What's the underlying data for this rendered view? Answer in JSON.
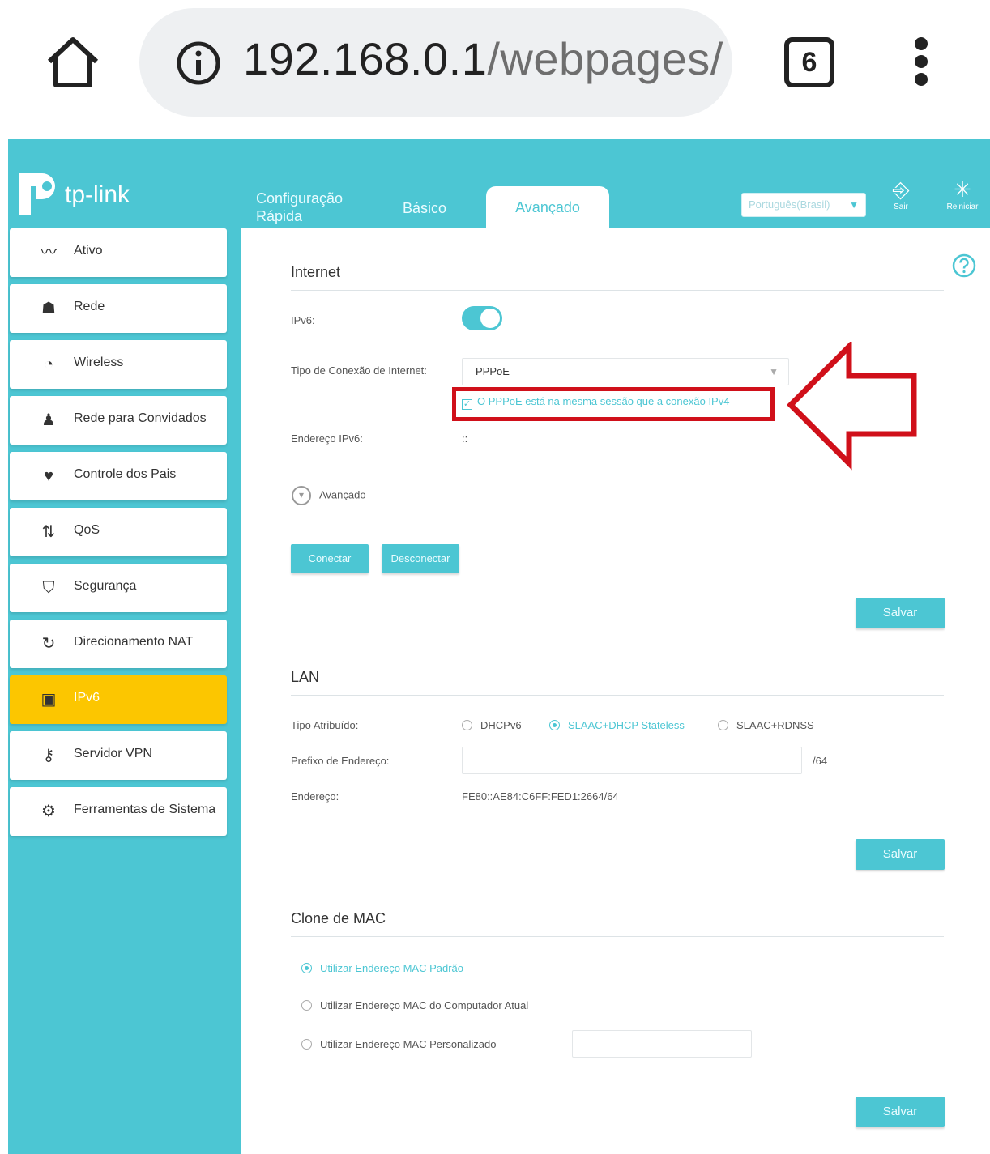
{
  "browser": {
    "url_host": "192.168.0.1",
    "url_path": "/webpages/",
    "tab_count": "6"
  },
  "brand": {
    "logo_text": "tp-link"
  },
  "top_nav": {
    "tabs": [
      {
        "label": "Configuração Rápida"
      },
      {
        "label": "Básico"
      },
      {
        "label": "Avançado"
      }
    ],
    "language": "Português(Brasil)",
    "logout_label": "Sair",
    "reboot_label": "Reiniciar"
  },
  "sidebar": {
    "items": [
      {
        "label": "Ativo",
        "icon": "pulse-icon"
      },
      {
        "label": "Rede",
        "icon": "network-icon"
      },
      {
        "label": "Wireless",
        "icon": "wifi-icon"
      },
      {
        "label": "Rede para Convidados",
        "icon": "guests-icon"
      },
      {
        "label": "Controle dos Pais",
        "icon": "heart-icon"
      },
      {
        "label": "QoS",
        "icon": "arrows-icon"
      },
      {
        "label": "Segurança",
        "icon": "shield-icon"
      },
      {
        "label": "Direcionamento NAT",
        "icon": "refresh-icon"
      },
      {
        "label": "IPv6",
        "icon": "ipv6-icon",
        "active": true
      },
      {
        "label": "Servidor VPN",
        "icon": "key-icon"
      },
      {
        "label": "Ferramentas de Sistema",
        "icon": "gear-icon"
      }
    ]
  },
  "internet": {
    "title": "Internet",
    "ipv6_label": "IPv6:",
    "ipv6_enabled": true,
    "conn_type_label": "Tipo de Conexão de Internet:",
    "conn_type_value": "PPPoE",
    "same_session_label": "O PPPoE está na mesma sessão que a conexão IPv4",
    "same_session_checked": true,
    "ipv6_addr_label": "Endereço IPv6:",
    "ipv6_addr_value": "::",
    "advanced_label": "Avançado",
    "connect_label": "Conectar",
    "disconnect_label": "Desconectar",
    "save_label": "Salvar"
  },
  "lan": {
    "title": "LAN",
    "assign_type_label": "Tipo Atribuído:",
    "options": [
      "DHCPv6",
      "SLAAC+DHCP Stateless",
      "SLAAC+RDNSS"
    ],
    "selected_option": "SLAAC+DHCP Stateless",
    "prefix_label": "Prefixo de Endereço:",
    "prefix_value": "",
    "prefix_suffix": "/64",
    "address_label": "Endereço:",
    "address_value": "FE80::AE84:C6FF:FED1:2664/64",
    "save_label": "Salvar"
  },
  "mac_clone": {
    "title": "Clone de MAC",
    "options": [
      "Utilizar Endereço MAC Padrão",
      "Utilizar Endereço MAC do Computador Atual",
      "Utilizar Endereço MAC Personalizado"
    ],
    "selected_option": "Utilizar Endereço MAC Padrão",
    "custom_mac_value": "",
    "save_label": "Salvar"
  },
  "colors": {
    "accent": "#4cc6d3",
    "active_menu": "#fcc600",
    "highlight_red": "#d0101a"
  }
}
